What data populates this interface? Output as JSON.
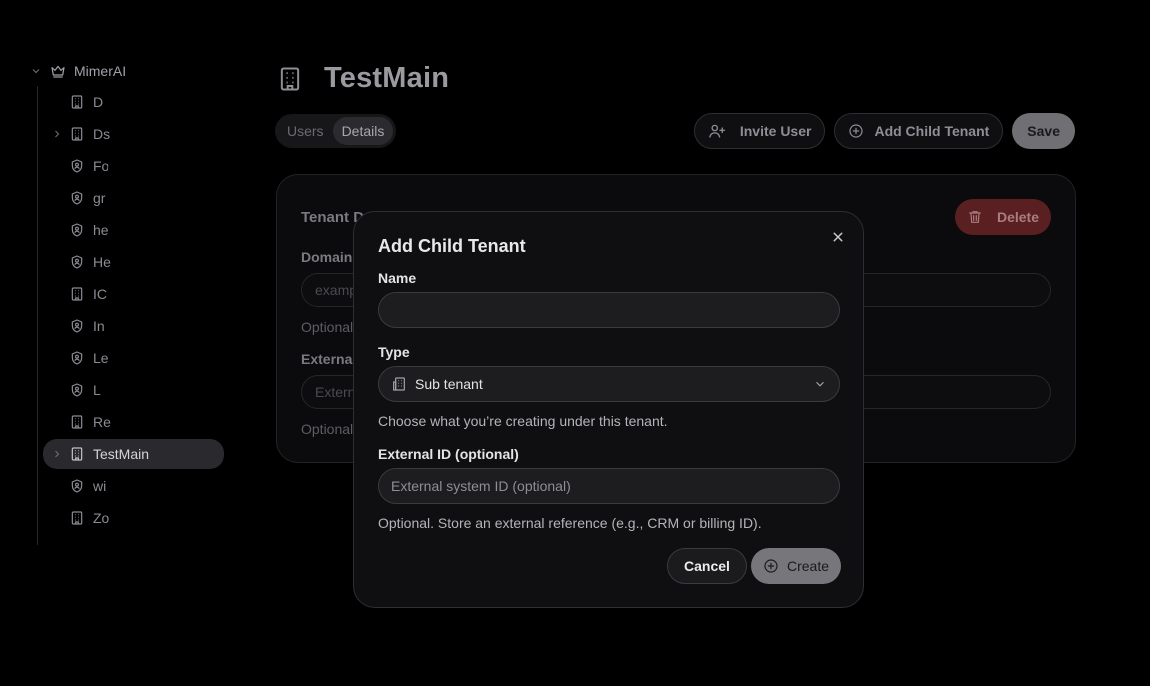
{
  "sidebar": {
    "root": {
      "label": "MimerAI",
      "expanded": true
    },
    "items": [
      {
        "label": "D",
        "icon": "building-icon",
        "has_children": false
      },
      {
        "label": "Ds",
        "icon": "building-icon",
        "has_children": true
      },
      {
        "label": "Fo",
        "icon": "shield-icon",
        "has_children": false
      },
      {
        "label": "gr",
        "icon": "shield-icon",
        "has_children": false
      },
      {
        "label": "he",
        "icon": "shield-icon",
        "has_children": false
      },
      {
        "label": "He",
        "icon": "shield-icon",
        "has_children": false
      },
      {
        "label": "IC",
        "icon": "building-icon",
        "has_children": false
      },
      {
        "label": "In",
        "icon": "shield-icon",
        "has_children": false
      },
      {
        "label": "Le",
        "icon": "shield-icon",
        "has_children": false
      },
      {
        "label": "L",
        "icon": "shield-icon",
        "has_children": false
      },
      {
        "label": "Re",
        "icon": "building-icon",
        "has_children": false
      },
      {
        "label": "TestMain",
        "icon": "building-icon",
        "has_children": true,
        "active": true
      },
      {
        "label": "wi",
        "icon": "shield-icon",
        "has_children": false
      },
      {
        "label": "Zo",
        "icon": "building-icon",
        "has_children": false
      }
    ]
  },
  "header": {
    "title": "TestMain",
    "tabs": [
      {
        "label": "Users",
        "active": false
      },
      {
        "label": "Details",
        "active": true
      }
    ],
    "actions": {
      "invite_user": "Invite User",
      "add_child_tenant": "Add Child Tenant",
      "save": "Save"
    }
  },
  "details_card": {
    "title": "Tenant D",
    "delete_label": "Delete",
    "fields": [
      {
        "label": "Domain",
        "placeholder": "examp",
        "help": "Optional"
      },
      {
        "label": "External",
        "placeholder": "Externa",
        "help": "Optional"
      }
    ]
  },
  "modal": {
    "title": "Add Child Tenant",
    "name": {
      "label": "Name",
      "value": ""
    },
    "type": {
      "label": "Type",
      "selected": "Sub tenant",
      "help": "Choose what you’re creating under this tenant."
    },
    "external_id": {
      "label": "External ID (optional)",
      "placeholder": "External system ID (optional)",
      "help": "Optional. Store an external reference (e.g., CRM or billing ID)."
    },
    "cancel_label": "Cancel",
    "create_label": "Create"
  },
  "colors": {
    "background": "#000000",
    "modal_bg": "#0f0f11",
    "delete_bg": "#5a1f21",
    "primary_button": "#77777b"
  }
}
